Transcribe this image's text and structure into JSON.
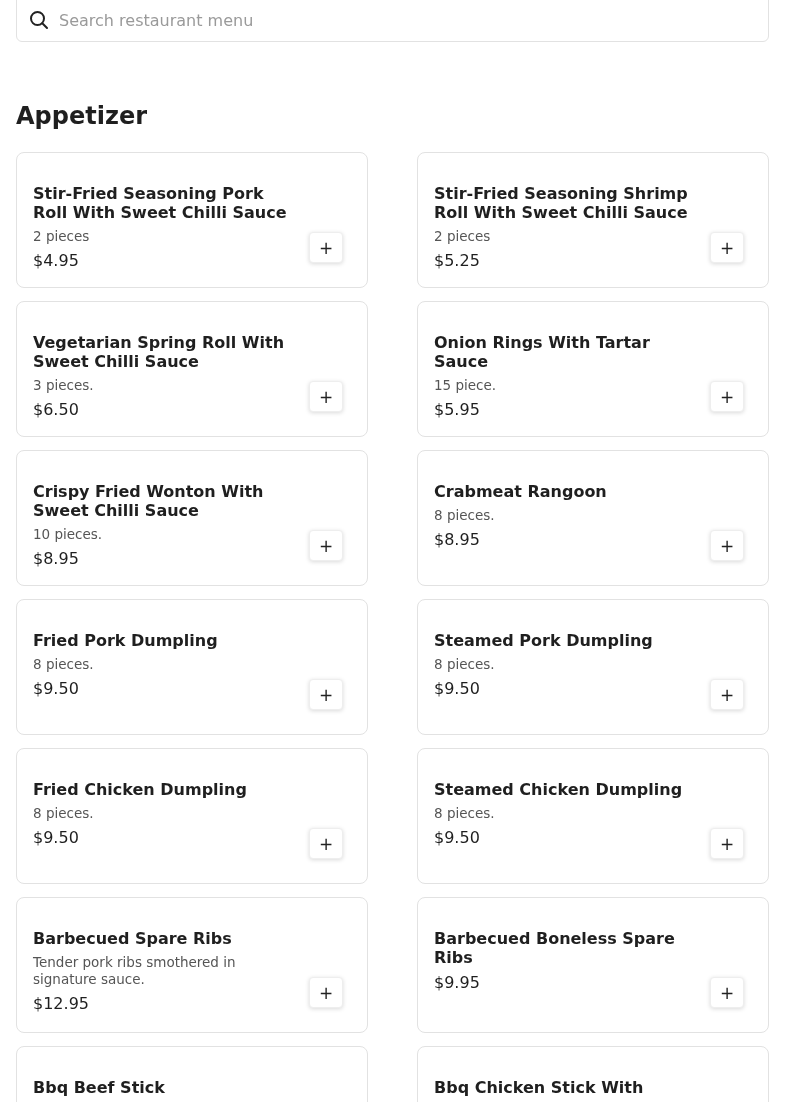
{
  "search": {
    "placeholder": "Search restaurant menu"
  },
  "section": {
    "title": "Appetizer",
    "items": [
      {
        "name": "Stir-Fried Seasoning Pork Roll With Sweet Chilli Sauce",
        "description": "2 pieces",
        "price": "$4.95",
        "add": "+"
      },
      {
        "name": "Stir-Fried Seasoning Shrimp Roll With Sweet Chilli Sauce",
        "description": "2 pieces",
        "price": "$5.25",
        "add": "+"
      },
      {
        "name": "Vegetarian Spring Roll With Sweet Chilli Sauce",
        "description": "3 pieces.",
        "price": "$6.50",
        "add": "+"
      },
      {
        "name": "Onion Rings With Tartar Sauce",
        "description": "15 piece.",
        "price": "$5.95",
        "add": "+"
      },
      {
        "name": "Crispy Fried Wonton With Sweet Chilli Sauce",
        "description": "10 pieces.",
        "price": "$8.95",
        "add": "+"
      },
      {
        "name": "Crabmeat Rangoon",
        "description": "8 pieces.",
        "price": "$8.95",
        "add": "+"
      },
      {
        "name": "Fried Pork Dumpling",
        "description": "8 pieces.",
        "price": "$9.50",
        "add": "+"
      },
      {
        "name": "Steamed Pork Dumpling",
        "description": "8 pieces.",
        "price": "$9.50",
        "add": "+"
      },
      {
        "name": "Fried Chicken Dumpling",
        "description": "8 pieces.",
        "price": "$9.50",
        "add": "+"
      },
      {
        "name": "Steamed Chicken Dumpling",
        "description": "8 pieces.",
        "price": "$9.50",
        "add": "+"
      },
      {
        "name": "Barbecued Spare Ribs",
        "description": "Tender pork ribs smothered in signature sauce.",
        "price": "$12.95",
        "add": "+"
      },
      {
        "name": "Barbecued Boneless Spare Ribs",
        "price": "$9.95",
        "add": "+"
      },
      {
        "name": "Bbq Beef Stick"
      },
      {
        "name": "Bbq Chicken Stick With"
      }
    ]
  }
}
